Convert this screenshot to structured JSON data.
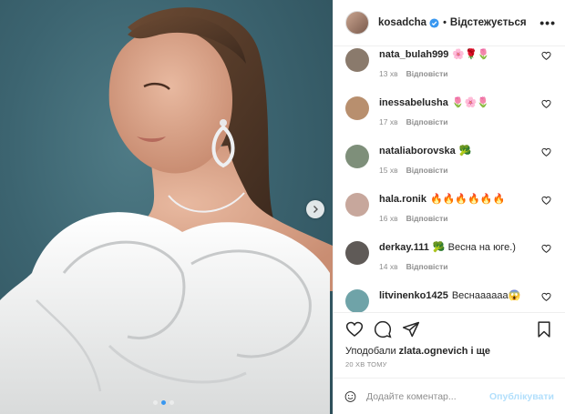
{
  "photo": {
    "alt_icon_next": "chevron-right-icon",
    "carousel_dots": 3,
    "carousel_active_index": 1
  },
  "header": {
    "username": "kosadcha",
    "separator": "•",
    "follow_status": "Відстежується",
    "more": "•••"
  },
  "comments": [
    {
      "user": "nata_bulah999",
      "text": "🌸🌹🌷",
      "time": "13 хв",
      "reply": "Відповісти",
      "avatar_color": "#8a7a6c"
    },
    {
      "user": "inessabelusha",
      "text": "🌷🌸🌷",
      "time": "17 хв",
      "reply": "Відповісти",
      "avatar_color": "#b88f6e"
    },
    {
      "user": "nataliaborovska",
      "text": "🥦",
      "time": "15 хв",
      "reply": "Відповісти",
      "avatar_color": "#7e8f7a"
    },
    {
      "user": "hala.ronik",
      "text": "🔥🔥🔥🔥🔥🔥",
      "time": "16 хв",
      "reply": "Відповісти",
      "avatar_color": "#c7a79c"
    },
    {
      "user": "derkay.111",
      "text": "🥦 Весна на юге.)",
      "time": "14 хв",
      "reply": "Відповісти",
      "avatar_color": "#5f5a57"
    },
    {
      "user": "litvinenko1425",
      "text": "Веснаааааа😱",
      "time": "",
      "reply": "",
      "avatar_color": "#6fa3a8"
    }
  ],
  "likes": {
    "prefix": "Уподобали",
    "user": "zlata.ognevich",
    "suffix": "і ще"
  },
  "time_ago": "20 ХВ ТОМУ",
  "add_comment": {
    "placeholder": "Додайте коментар...",
    "post_label": "Опублікувати"
  },
  "colors": {
    "accent": "#3897f0",
    "post_disabled": "#b2dffc",
    "background_photo": "#3c6470"
  }
}
